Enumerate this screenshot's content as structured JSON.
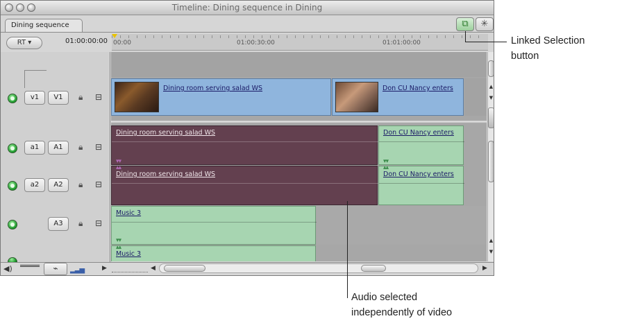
{
  "window": {
    "title": "Timeline: Dining sequence in Dining",
    "tab_label": "Dining sequence"
  },
  "toolbar": {
    "rt_label": "RT ▾",
    "timecode": "01:00:00:00",
    "linked_selection_icon": "linked-selection-icon",
    "snapping_icon": "snapping-icon"
  },
  "ruler": {
    "labels": [
      "00:00",
      "01:00:30:00",
      "01:01:00:00"
    ]
  },
  "tracks": {
    "v1": {
      "source": "v1",
      "dest": "V1"
    },
    "a1": {
      "source": "a1",
      "dest": "A1"
    },
    "a2": {
      "source": "a2",
      "dest": "A2"
    },
    "a3": {
      "dest": "A3"
    }
  },
  "clips": {
    "v1_clip1": "Dining room serving salad WS",
    "v1_clip2": "Don CU Nancy enters",
    "a1_clip1": "Dining room serving salad WS",
    "a1_clip2": "Don CU Nancy enters",
    "a2_clip1": "Dining room serving salad WS",
    "a2_clip2": "Don CU Nancy enters",
    "a3_clip1": "Music 3",
    "a4_clip1": "Music 3"
  },
  "callouts": {
    "linked_selection": [
      "Linked Selection",
      "button"
    ],
    "audio_selected": [
      "Audio selected",
      "independently of video"
    ]
  },
  "colors": {
    "video_clip": "#8fb5dd",
    "audio_selected": "#63404f",
    "audio_clip": "#a7d5b1"
  }
}
